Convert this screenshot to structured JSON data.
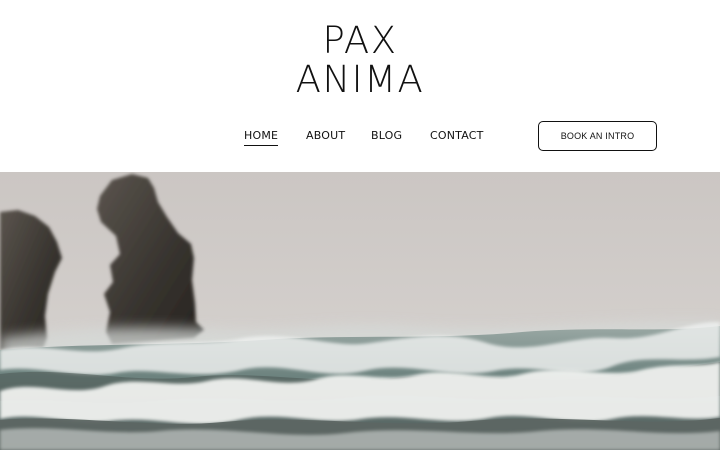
{
  "brand": {
    "logo_line_1": "PAX",
    "logo_line_2": "ANIMA"
  },
  "navigation": {
    "items": [
      {
        "label": "HOME",
        "active": true
      },
      {
        "label": "ABOUT",
        "active": false
      },
      {
        "label": "BLOG",
        "active": false
      },
      {
        "label": "CONTACT",
        "active": false
      }
    ]
  },
  "cta": {
    "label": "BOOK AN INTRO"
  },
  "hero": {
    "scene": "coastal-rocks-and-waves"
  },
  "colors": {
    "text": "#111111",
    "background": "#ffffff",
    "hero_sky": "#cfcac7",
    "rock": "#3a352f",
    "sea_foam": "#eceeed",
    "sea_water": "#6f8c86"
  }
}
